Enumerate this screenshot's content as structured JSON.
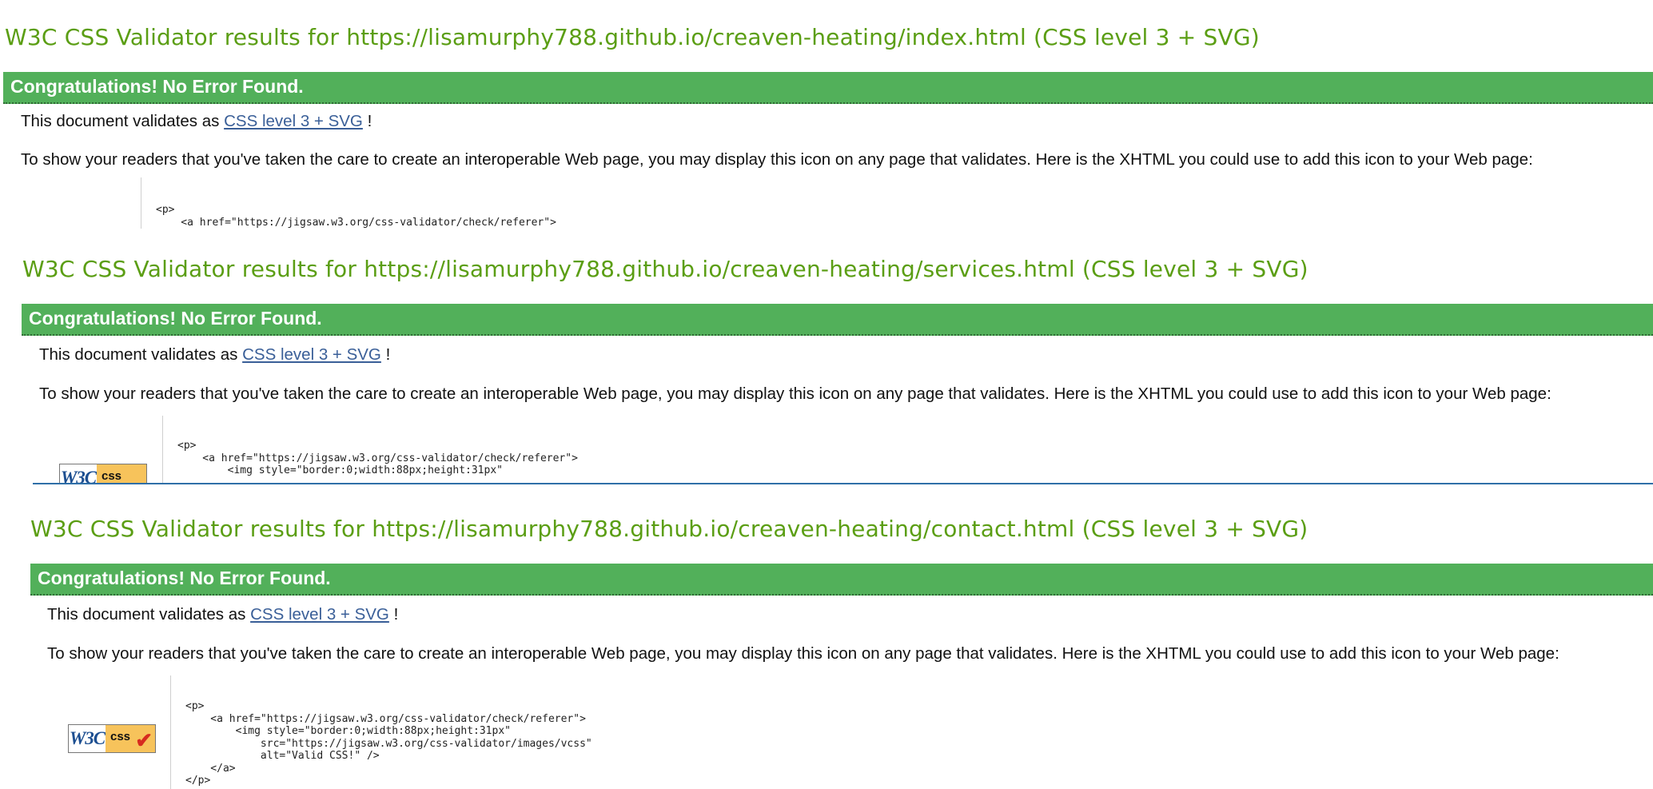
{
  "sections": [
    {
      "title": "W3C CSS Validator results for https://lisamurphy788.github.io/creaven-heating/index.html (CSS level 3 + SVG)",
      "banner": "Congratulations! No Error Found.",
      "validates_prefix": "This document validates as ",
      "validates_link": "CSS level 3 + SVG",
      "validates_suffix": " !",
      "show_text": "To show your readers that you've taken the care to create an interoperable Web page, you may display this icon on any page that validates. Here is the XHTML you could use to add this icon to your Web page:",
      "code": "<p>\n    <a href=\"https://jigsaw.w3.org/css-validator/check/referer\">"
    },
    {
      "title": "W3C CSS Validator results for https://lisamurphy788.github.io/creaven-heating/services.html (CSS level 3 + SVG)",
      "banner": "Congratulations! No Error Found.",
      "validates_prefix": "This document validates as ",
      "validates_link": "CSS level 3 + SVG",
      "validates_suffix": " !",
      "show_text": "To show your readers that you've taken the care to create an interoperable Web page, you may display this icon on any page that validates. Here is the XHTML you could use to add this icon to your Web page:",
      "code": "<p>\n    <a href=\"https://jigsaw.w3.org/css-validator/check/referer\">\n        <img style=\"border:0;width:88px;height:31px\""
    },
    {
      "title": "W3C CSS Validator results for https://lisamurphy788.github.io/creaven-heating/contact.html (CSS level 3 + SVG)",
      "banner": "Congratulations! No Error Found.",
      "validates_prefix": "This document validates as ",
      "validates_link": "CSS level 3 + SVG",
      "validates_suffix": " !",
      "show_text": "To show your readers that you've taken the care to create an interoperable Web page, you may display this icon on any page that validates. Here is the XHTML you could use to add this icon to your Web page:",
      "code": "<p>\n    <a href=\"https://jigsaw.w3.org/css-validator/check/referer\">\n        <img style=\"border:0;width:88px;height:31px\"\n            src=\"https://jigsaw.w3.org/css-validator/images/vcss\"\n            alt=\"Valid CSS!\" />\n    </a>\n</p>"
    }
  ],
  "badge": {
    "w3": "W3C",
    "css": "css",
    "icon": "w3c-valid-css-badge-icon"
  },
  "colors": {
    "title": "#5b9e14",
    "banner": "#52b05a",
    "link": "#3a5f98",
    "divider": "#2f6fa8"
  }
}
